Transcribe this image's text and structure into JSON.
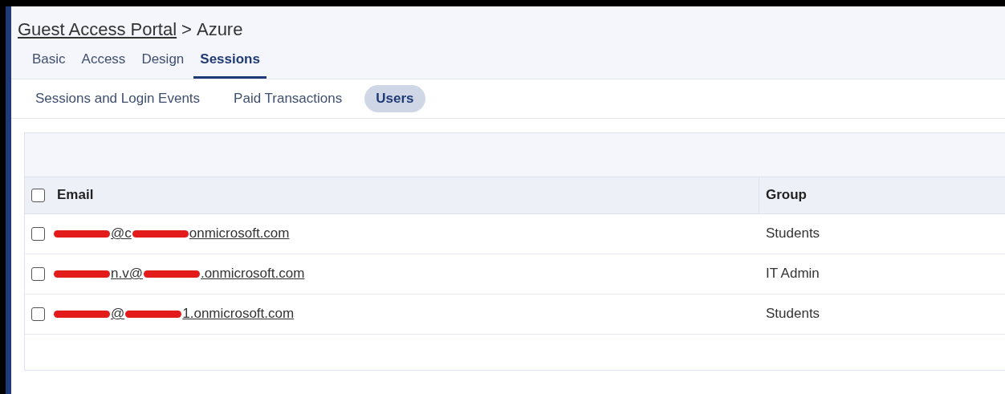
{
  "breadcrumb": {
    "link": "Guest Access Portal",
    "separator": ">",
    "current": "Azure"
  },
  "tabs": [
    {
      "label": "Basic",
      "selected": false
    },
    {
      "label": "Access",
      "selected": false
    },
    {
      "label": "Design",
      "selected": false
    },
    {
      "label": "Sessions",
      "selected": true
    }
  ],
  "subtabs": [
    {
      "label": "Sessions and Login Events",
      "selected": false
    },
    {
      "label": "Paid Transactions",
      "selected": false
    },
    {
      "label": "Users",
      "selected": true
    }
  ],
  "table": {
    "select_all": {
      "checked": false
    },
    "columns": [
      "Email",
      "Group"
    ],
    "rows": [
      {
        "checked": false,
        "email": [
          {
            "kind": "redacted"
          },
          {
            "kind": "text",
            "text": "@c"
          },
          {
            "kind": "redacted"
          },
          {
            "kind": "text",
            "text": "onmicrosoft.com"
          }
        ],
        "group": "Students"
      },
      {
        "checked": false,
        "email": [
          {
            "kind": "redacted"
          },
          {
            "kind": "text",
            "text": "n.v@"
          },
          {
            "kind": "redacted"
          },
          {
            "kind": "text",
            "text": ".onmicrosoft.com"
          }
        ],
        "group": "IT Admin"
      },
      {
        "checked": false,
        "email": [
          {
            "kind": "redacted"
          },
          {
            "kind": "text",
            "text": "@"
          },
          {
            "kind": "redacted"
          },
          {
            "kind": "text",
            "text": "1.onmicrosoft.com"
          }
        ],
        "group": "Students"
      }
    ]
  }
}
